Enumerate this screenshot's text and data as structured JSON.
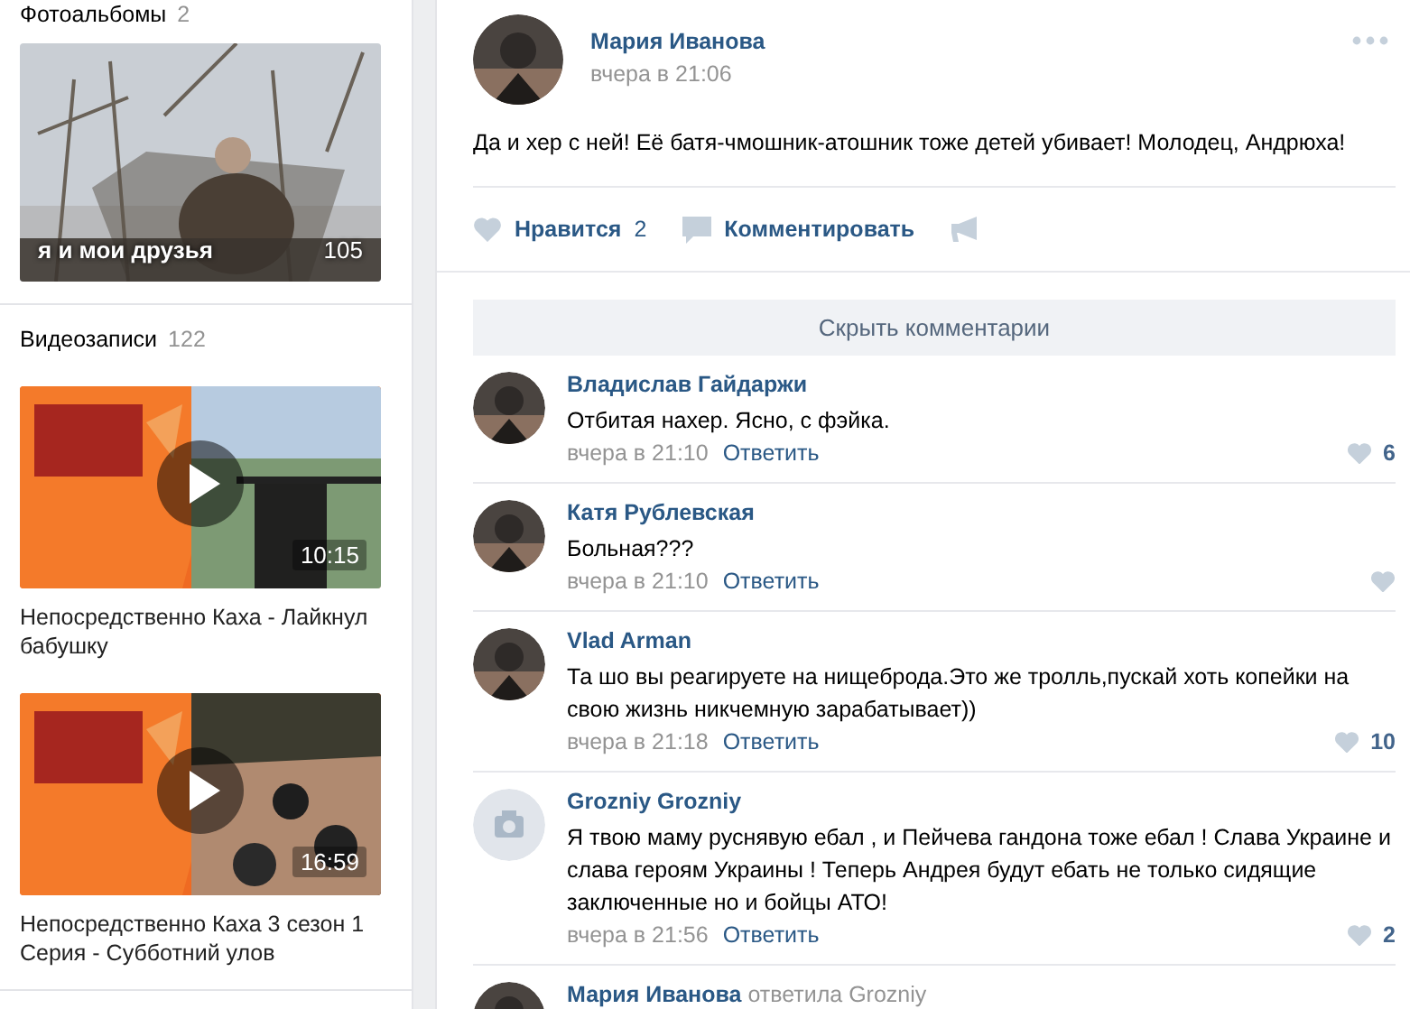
{
  "left": {
    "albums": {
      "title": "Фотоальбомы",
      "count": "2",
      "items": [
        {
          "caption": "я и мои друзья",
          "count": "105"
        }
      ]
    },
    "videos": {
      "title": "Видеозаписи",
      "count": "122",
      "items": [
        {
          "duration": "10:15",
          "title": "Непосредственно Каха - Лайкнул бабушку"
        },
        {
          "duration": "16:59",
          "title": "Непосредственно Каха 3 сезон 1 Серия - Субботний улов"
        }
      ]
    }
  },
  "post": {
    "author": "Мария Иванова",
    "time": "вчера в 21:06",
    "text": "Да и хер с ней! Её батя-чмошник-атошник тоже детей убивает! Молодец, Андрюха!",
    "like_label": "Нравится",
    "like_count": "2",
    "comment_label": "Комментировать",
    "hide_comments": "Скрыть комментарии",
    "comments": [
      {
        "author": "Владислав Гайдаржи",
        "text": "Отбитая нахер. Ясно, с фэйка.",
        "time": "вчера в 21:10",
        "reply": "Ответить",
        "likes": "6"
      },
      {
        "author": "Катя Рублевская",
        "text": "Больная???",
        "time": "вчера в 21:10",
        "reply": "Ответить"
      },
      {
        "author": "Vlad Arman",
        "text": "Та шо вы реагируете на нищеброда.Это же тролль,пускай хоть копейки на свою жизнь никчемную зарабатывает))",
        "time": "вчера в 21:18",
        "reply": "Ответить",
        "likes": "10"
      },
      {
        "kind": "placeholder",
        "author": "Grozniy Grozniy",
        "text": "Я твою маму руснявую ебал , и Пейчева гандона тоже ебал ! Слава Украине и слава героям Украины ! Теперь Андрея будут ебать не только сидящие заключенные но и бойцы АТО!",
        "time": "вчера в 21:56",
        "reply": "Ответить",
        "likes": "2"
      },
      {
        "author": "Мария Иванова",
        "reply_to": "ответила Grozniy"
      }
    ]
  }
}
